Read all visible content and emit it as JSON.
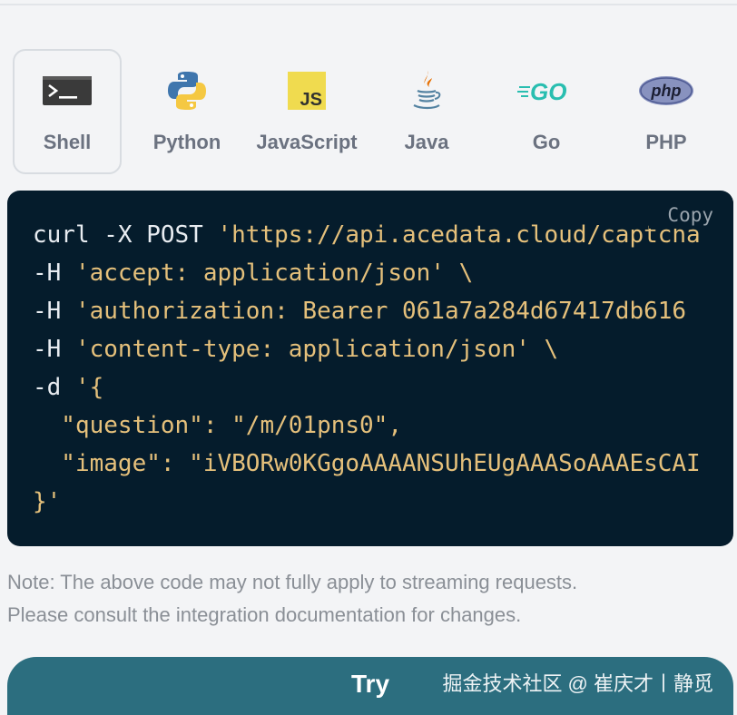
{
  "language_tabs": [
    {
      "label": "Shell",
      "icon": "terminal-icon",
      "active": true
    },
    {
      "label": "Python",
      "icon": "python-icon"
    },
    {
      "label": "JavaScript",
      "icon": "javascript-icon"
    },
    {
      "label": "Java",
      "icon": "java-icon"
    },
    {
      "label": "Go",
      "icon": "go-icon"
    },
    {
      "label": "PHP",
      "icon": "php-icon"
    }
  ],
  "icon_text": {
    "javascript": "JS",
    "go": "GO",
    "php": "php"
  },
  "code": {
    "copy_label": "Copy",
    "lines": [
      {
        "cmd": "curl -X POST ",
        "str": "'https://api.acedata.cloud/captcha"
      },
      {
        "cmd": "-H ",
        "str": "'accept: application/json' \\"
      },
      {
        "cmd": "-H ",
        "str": "'authorization: Bearer 061a7a284d67417db616"
      },
      {
        "cmd": "-H ",
        "str": "'content-type: application/json' \\"
      },
      {
        "cmd": "-d ",
        "str": "'{"
      },
      {
        "cmd": "",
        "str": "  \"question\": \"/m/01pns0\","
      },
      {
        "cmd": "",
        "str": "  \"image\": \"iVBORw0KGgoAAAANSUhEUgAAASoAAAEsCAI"
      },
      {
        "cmd": "",
        "str": "}'"
      }
    ]
  },
  "note": {
    "line1": "Note: The above code may not fully apply to streaming requests.",
    "line2": "Please consult the integration documentation for changes."
  },
  "try_button": {
    "label": "Try"
  },
  "watermark": {
    "text": "掘金技术社区 @ 崔庆才丨静觅"
  },
  "colors": {
    "code_background": "#051c2c",
    "code_string": "#e5c07b",
    "code_command": "#e8ecf1",
    "try_button": "#2c6e7f",
    "go_brand": "#29beb0",
    "php_brand": "#8892bf",
    "js_brand": "#f0db4f"
  }
}
